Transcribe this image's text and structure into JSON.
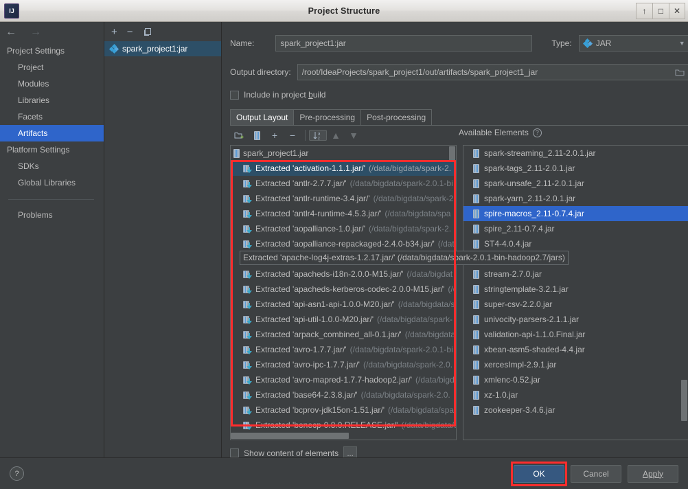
{
  "window": {
    "title": "Project Structure",
    "app_icon": "intellij-idea-icon",
    "buttons": {
      "minimize": "↑",
      "maximize": "□",
      "close": "✕"
    }
  },
  "nav": {
    "back_icon": "←",
    "forward_icon": "→",
    "sections": [
      {
        "label": "Project Settings",
        "type": "group"
      },
      {
        "label": "Project",
        "type": "item",
        "selected": false
      },
      {
        "label": "Modules",
        "type": "item",
        "selected": false
      },
      {
        "label": "Libraries",
        "type": "item",
        "selected": false
      },
      {
        "label": "Facets",
        "type": "item",
        "selected": false
      },
      {
        "label": "Artifacts",
        "type": "item",
        "selected": true
      },
      {
        "label": "Platform Settings",
        "type": "group"
      },
      {
        "label": "SDKs",
        "type": "item",
        "selected": false
      },
      {
        "label": "Global Libraries",
        "type": "item",
        "selected": false
      },
      {
        "label": "Problems",
        "type": "item",
        "selected": false,
        "after_separator": true
      }
    ]
  },
  "artifacts_panel": {
    "toolbar": {
      "add": "+",
      "remove": "−",
      "copy": "copy-icon"
    },
    "items": [
      {
        "label": "spark_project1:jar",
        "selected": true
      }
    ]
  },
  "detail": {
    "name_label": "Name:",
    "name_value": "spark_project1:jar",
    "type_label": "Type:",
    "type_value": "JAR",
    "output_dir_label": "Output directory:",
    "output_dir_value": "/root/IdeaProjects/spark_project1/out/artifacts/spark_project1_jar",
    "include_in_build_label": "Include in project build",
    "include_in_build_checked": false,
    "tabs": [
      {
        "label": "Output Layout",
        "active": true
      },
      {
        "label": "Pre-processing",
        "active": false
      },
      {
        "label": "Post-processing",
        "active": false
      }
    ],
    "layout_toolbar": [
      "add-directory-icon",
      "add-archive-icon",
      "add-icon",
      "remove-icon",
      "sort-alphabetically-icon",
      "move-up-icon",
      "move-down-icon"
    ],
    "available_elements_label": "Available Elements",
    "available_elements_help": "?",
    "show_content_label": "Show content of elements",
    "show_content_checked": false,
    "ellipsis_button": "..."
  },
  "output_tree": {
    "root": {
      "label": "spark_project1.jar",
      "icon": "jar-icon"
    },
    "items": [
      {
        "name": "Extracted 'activation-1.1.1.jar/'",
        "path": "(/data/bigdata/spark-2.",
        "selected": true
      },
      {
        "name": "Extracted 'antlr-2.7.7.jar/'",
        "path": "(/data/bigdata/spark-2.0.1-bi",
        "selected": false
      },
      {
        "name": "Extracted 'antlr-runtime-3.4.jar/'",
        "path": "(/data/bigdata/spark-2",
        "selected": false
      },
      {
        "name": "Extracted 'antlr4-runtime-4.5.3.jar/'",
        "path": "(/data/bigdata/spa",
        "selected": false
      },
      {
        "name": "Extracted 'aopalliance-1.0.jar/'",
        "path": "(/data/bigdata/spark-2.",
        "selected": false
      },
      {
        "name": "Extracted 'aopalliance-repackaged-2.4.0-b34.jar/'",
        "path": "(/dat",
        "selected": false
      },
      {
        "name": "Extracted 'apache-log4j-extras-1.2.17.jar/'",
        "path": "(/data/bigdata",
        "selected": false
      },
      {
        "name": "Extracted 'apacheds-i18n-2.0.0-M15.jar/'",
        "path": "(/data/bigdat",
        "selected": false
      },
      {
        "name": "Extracted 'apacheds-kerberos-codec-2.0.0-M15.jar/'",
        "path": "(/d",
        "selected": false
      },
      {
        "name": "Extracted 'api-asn1-api-1.0.0-M20.jar/'",
        "path": "(/data/bigdata/s",
        "selected": false
      },
      {
        "name": "Extracted 'api-util-1.0.0-M20.jar/'",
        "path": "(/data/bigdata/spark-",
        "selected": false
      },
      {
        "name": "Extracted 'arpack_combined_all-0.1.jar/'",
        "path": "(/data/bigdata",
        "selected": false
      },
      {
        "name": "Extracted 'avro-1.7.7.jar/'",
        "path": "(/data/bigdata/spark-2.0.1-bi",
        "selected": false
      },
      {
        "name": "Extracted 'avro-ipc-1.7.7.jar/'",
        "path": "(/data/bigdata/spark-2.0.",
        "selected": false
      },
      {
        "name": "Extracted 'avro-mapred-1.7.7-hadoop2.jar/'",
        "path": "(/data/bigd",
        "selected": false
      },
      {
        "name": "Extracted 'base64-2.3.8.jar/'",
        "path": "(/data/bigdata/spark-2.0.",
        "selected": false
      },
      {
        "name": "Extracted 'bcprov-jdk15on-1.51.jar/'",
        "path": "(/data/bigdata/spa",
        "selected": false
      },
      {
        "name": "Extracted 'bonecp-0.8.0.RELEASE.jar/'",
        "path": "(/data/bigdata/s",
        "selected": false
      }
    ],
    "hover_tooltip": "Extracted 'apache-log4j-extras-1.2.17.jar/' (/data/bigdata/spark-2.0.1-bin-hadoop2.7/jars)"
  },
  "available_elements": {
    "items": [
      {
        "label": "spark-streaming_2.11-2.0.1.jar",
        "selected": false
      },
      {
        "label": "spark-tags_2.11-2.0.1.jar",
        "selected": false
      },
      {
        "label": "spark-unsafe_2.11-2.0.1.jar",
        "selected": false
      },
      {
        "label": "spark-yarn_2.11-2.0.1.jar",
        "selected": false
      },
      {
        "label": "spire-macros_2.11-0.7.4.jar",
        "selected": true
      },
      {
        "label": "spire_2.11-0.7.4.jar",
        "selected": false
      },
      {
        "label": "ST4-4.0.4.jar",
        "selected": false
      },
      {
        "label": "stax-api-1.0.1.jar",
        "selected": false
      },
      {
        "label": "stream-2.7.0.jar",
        "selected": false
      },
      {
        "label": "stringtemplate-3.2.1.jar",
        "selected": false
      },
      {
        "label": "super-csv-2.2.0.jar",
        "selected": false
      },
      {
        "label": "univocity-parsers-2.1.1.jar",
        "selected": false
      },
      {
        "label": "validation-api-1.1.0.Final.jar",
        "selected": false
      },
      {
        "label": "xbean-asm5-shaded-4.4.jar",
        "selected": false
      },
      {
        "label": "xercesImpl-2.9.1.jar",
        "selected": false
      },
      {
        "label": "xmlenc-0.52.jar",
        "selected": false
      },
      {
        "label": "xz-1.0.jar",
        "selected": false
      },
      {
        "label": "zookeeper-3.4.6.jar",
        "selected": false
      }
    ]
  },
  "footer": {
    "help_label": "?",
    "ok_label": "OK",
    "cancel_label": "Cancel",
    "apply_label": "Apply"
  },
  "colors": {
    "accent_selection": "#2f65ca",
    "tree_selection": "#2d4f67",
    "annotation_red": "#ff2d2d",
    "primary_button": "#365880",
    "background": "#3c3f41",
    "text": "#bbbbbb",
    "path_text": "#7b8186"
  }
}
